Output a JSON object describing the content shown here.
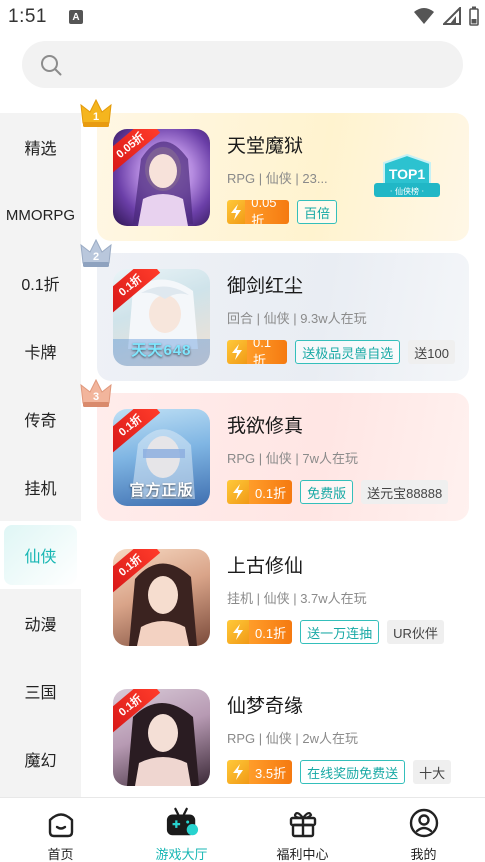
{
  "status_bar": {
    "time": "1:51",
    "notification_letter": "A"
  },
  "search": {
    "placeholder": ""
  },
  "sidebar": {
    "items": [
      {
        "label": "精选"
      },
      {
        "label": "MMORPG"
      },
      {
        "label": "0.1折"
      },
      {
        "label": "卡牌"
      },
      {
        "label": "传奇"
      },
      {
        "label": "挂机"
      },
      {
        "label": "仙侠",
        "active": true
      },
      {
        "label": "动漫"
      },
      {
        "label": "三国"
      },
      {
        "label": "魔幻"
      }
    ]
  },
  "games": [
    {
      "rank": "1",
      "title": "天堂魔狱",
      "meta": "RPG | 仙侠 | 23...",
      "discount": "0.05折",
      "thumb_ribbon": "0.05折",
      "thumb_text": "",
      "tags": [
        "百倍"
      ],
      "gray_tags": [],
      "top_badge": {
        "title": "TOP1",
        "subtitle": "· 仙侠榜 ·"
      }
    },
    {
      "rank": "2",
      "title": "御剑红尘",
      "meta": "回合 | 仙侠 | 9.3w人在玩",
      "discount": "0.1折",
      "thumb_ribbon": "0.1折",
      "thumb_text": "天天648",
      "tags": [
        "送极品灵兽自选"
      ],
      "gray_tags": [
        "送100"
      ]
    },
    {
      "rank": "3",
      "title": "我欲修真",
      "meta": "RPG | 仙侠 | 7w人在玩",
      "discount": "0.1折",
      "thumb_ribbon": "0.1折",
      "thumb_text": "官方正版",
      "tags": [
        "免费版"
      ],
      "gray_tags": [
        "送元宝88888"
      ]
    },
    {
      "rank": "",
      "title": "上古修仙",
      "meta": "挂机 | 仙侠 | 3.7w人在玩",
      "discount": "0.1折",
      "thumb_ribbon": "0.1折",
      "thumb_text": "",
      "tags": [
        "送一万连抽"
      ],
      "gray_tags": [
        "UR伙伴"
      ]
    },
    {
      "rank": "",
      "title": "仙梦奇缘",
      "meta": "RPG | 仙侠 | 2w人在玩",
      "discount": "3.5折",
      "thumb_ribbon": "0.1折",
      "thumb_text": "",
      "tags": [
        "在线奖励免费送"
      ],
      "gray_tags": [
        "十大"
      ]
    }
  ],
  "bottom_nav": [
    {
      "label": "首页",
      "icon": "home-face-icon"
    },
    {
      "label": "游戏大厅",
      "icon": "gamepad-icon",
      "active": true
    },
    {
      "label": "福利中心",
      "icon": "gift-icon"
    },
    {
      "label": "我的",
      "icon": "profile-icon"
    }
  ],
  "colors": {
    "accent": "#19b7b4",
    "discount_orange": "#f57a10",
    "ribbon_red": "#d81818"
  }
}
